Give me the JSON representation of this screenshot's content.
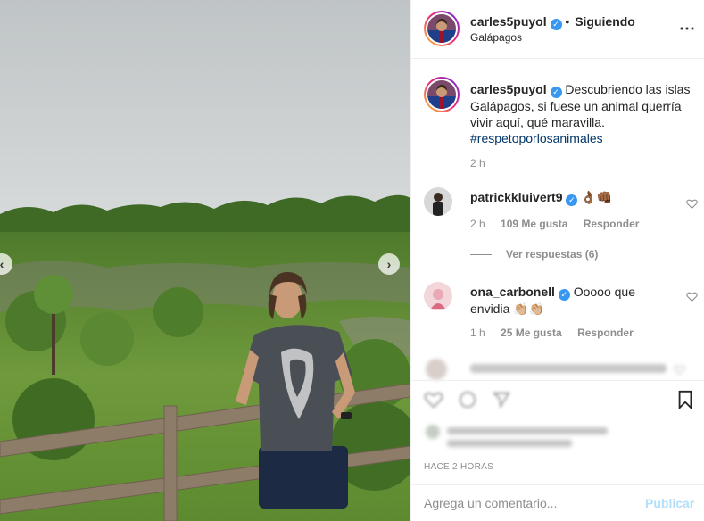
{
  "header": {
    "username": "carles5puyol",
    "follow_separator": "•",
    "follow_status": "Siguiendo",
    "location": "Galápagos",
    "more_icon": "⋯"
  },
  "caption": {
    "username": "carles5puyol",
    "text": "Descubriendo las islas Galápagos, si fuese un animal querría vivir aquí, qué maravilla.",
    "hashtag": "#respetoporlosanimales",
    "time": "2 h"
  },
  "comments": [
    {
      "username": "patrickkluivert9",
      "text": "👌🏾👊🏾",
      "time": "2 h",
      "likes": "109 Me gusta",
      "reply": "Responder"
    },
    {
      "username": "ona_carbonell",
      "text": "Ooooo que envidia 👏🏼👏🏼",
      "time": "1 h",
      "likes": "25 Me gusta",
      "reply": "Responder"
    }
  ],
  "view_replies": "Ver respuestas (6)",
  "timestamp": "HACE 2 HORAS",
  "add_comment": {
    "placeholder": "Agrega un comentario...",
    "publish": "Publicar"
  },
  "colors": {
    "verified": "#3897f0",
    "publish": "#b2dffc",
    "meta": "#8e8e8e"
  }
}
